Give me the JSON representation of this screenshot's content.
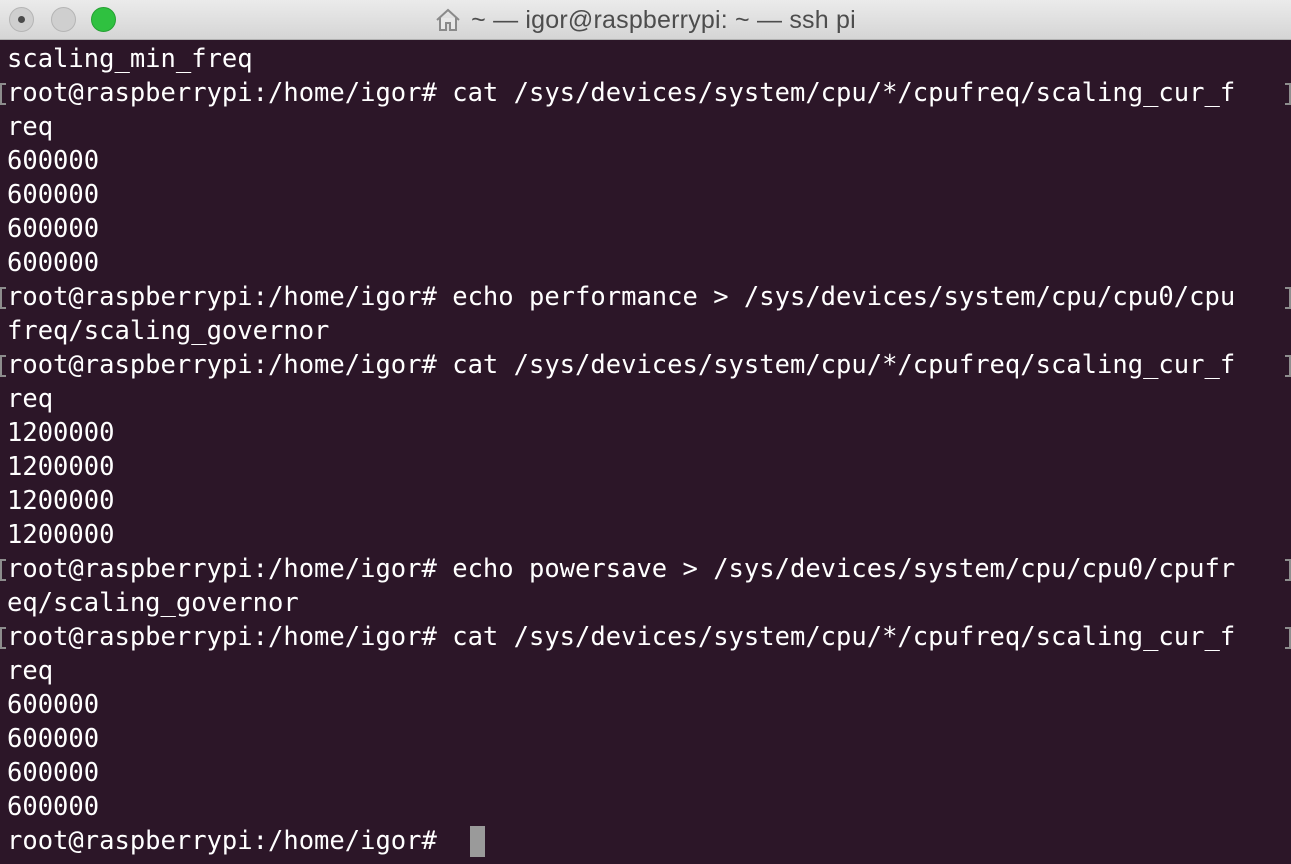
{
  "window": {
    "title": "~ — igor@raspberrypi: ~ — ssh pi"
  },
  "terminal": {
    "lines": [
      "scaling_min_freq",
      "root@raspberrypi:/home/igor# cat /sys/devices/system/cpu/*/cpufreq/scaling_cur_f",
      "req",
      "600000",
      "600000",
      "600000",
      "600000",
      "root@raspberrypi:/home/igor# echo performance > /sys/devices/system/cpu/cpu0/cpu",
      "freq/scaling_governor",
      "root@raspberrypi:/home/igor# cat /sys/devices/system/cpu/*/cpufreq/scaling_cur_f",
      "req",
      "1200000",
      "1200000",
      "1200000",
      "1200000",
      "root@raspberrypi:/home/igor# echo powersave > /sys/devices/system/cpu/cpu0/cpufr",
      "eq/scaling_governor",
      "root@raspberrypi:/home/igor# cat /sys/devices/system/cpu/*/cpufreq/scaling_cur_f",
      "req",
      "600000",
      "600000",
      "600000",
      "600000",
      "root@raspberrypi:/home/igor# "
    ]
  },
  "colors": {
    "background": "#2c1628",
    "text": "#ffffff",
    "cursor": "#9a9a9a"
  }
}
